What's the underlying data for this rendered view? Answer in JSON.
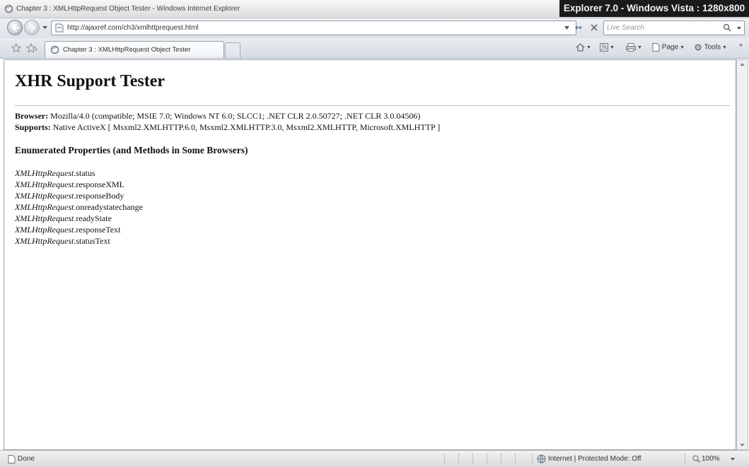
{
  "window": {
    "title": "Chapter 3 : XMLHttpRequest Object Tester - Windows Internet Explorer",
    "overlay_label": "Explorer 7.0 - Windows Vista : 1280x800"
  },
  "address_bar": {
    "url": "http://ajaxref.com/ch3/xmlhttprequest.html"
  },
  "search": {
    "placeholder": "Live Search"
  },
  "tabs": [
    {
      "label": "Chapter 3 : XMLHttpRequest Object Tester",
      "active": true
    }
  ],
  "command_bar": {
    "page_label": "Page",
    "tools_label": "Tools"
  },
  "page": {
    "title": "XHR Support Tester",
    "browser_label": "Browser:",
    "browser_value": " Mozilla/4.0 (compatible; MSIE 7.0; Windows NT 6.0; SLCC1; .NET CLR 2.0.50727; .NET CLR 3.0.04506)",
    "supports_label": "Supports:",
    "supports_value": " Native ActiveX [ Msxml2.XMLHTTP.6.0, Msxml2.XMLHTTP.3.0, Msxml2.XMLHTTP, Microsoft.XMLHTTP ]",
    "section_heading": "Enumerated Properties (and Methods in Some Browsers)",
    "properties": [
      {
        "object": "XMLHttpRequest",
        "member": ".status"
      },
      {
        "object": "XMLHttpRequest",
        "member": ".responseXML"
      },
      {
        "object": "XMLHttpRequest",
        "member": ".responseBody"
      },
      {
        "object": "XMLHttpRequest",
        "member": ".onreadystatechange"
      },
      {
        "object": "XMLHttpRequest",
        "member": ".readyState"
      },
      {
        "object": "XMLHttpRequest",
        "member": ".responseText"
      },
      {
        "object": "XMLHttpRequest",
        "member": ".statusText"
      }
    ]
  },
  "status_bar": {
    "status_text": "Done",
    "zone_text": "Internet | Protected Mode: Off",
    "zoom_text": "100%"
  },
  "icons": {
    "app": "ie-logo-icon",
    "back": "back-arrow-icon",
    "forward": "forward-arrow-icon",
    "page": "page-icon",
    "refresh": "refresh-icon",
    "stop": "stop-icon",
    "search": "search-icon",
    "favorites": "favorites-star-icon",
    "add_favorites": "add-favorites-icon",
    "home": "home-icon",
    "feeds": "feeds-icon",
    "print": "print-icon",
    "globe": "globe-icon",
    "zoom": "zoom-icon"
  }
}
